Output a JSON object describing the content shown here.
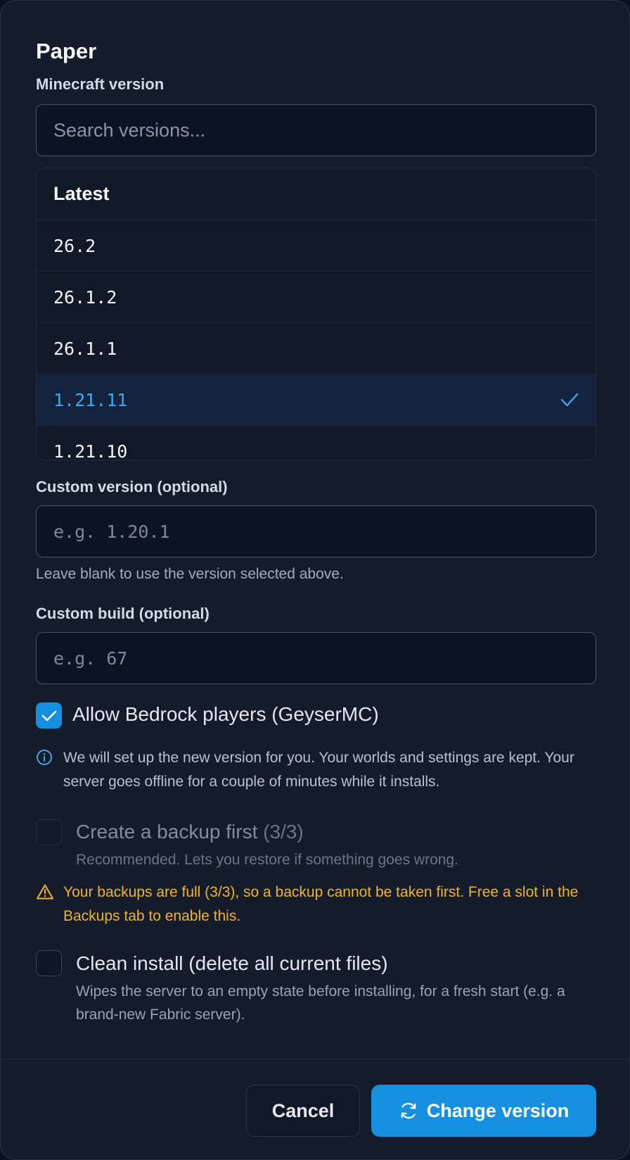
{
  "title": "Paper",
  "version_section": {
    "label": "Minecraft version",
    "search_placeholder": "Search versions...",
    "list_header": "Latest",
    "versions": [
      "26.2",
      "26.1.2",
      "26.1.1",
      "1.21.11",
      "1.21.10"
    ],
    "selected_version": "1.21.11"
  },
  "custom_version": {
    "label": "Custom version (optional)",
    "placeholder": "e.g. 1.20.1",
    "help": "Leave blank to use the version selected above."
  },
  "custom_build": {
    "label": "Custom build (optional)",
    "placeholder": "e.g. 67"
  },
  "bedrock": {
    "label": "Allow Bedrock players (GeyserMC)",
    "checked": true
  },
  "info_notice": "We will set up the new version for you. Your worlds and settings are kept. Your server goes offline for a couple of minutes while it installs.",
  "backup": {
    "label": "Create a backup first",
    "count": "(3/3)",
    "description": "Recommended. Lets you restore if something goes wrong.",
    "checked": false,
    "disabled": true
  },
  "warning_notice": "Your backups are full (3/3), so a backup cannot be taken first. Free a slot in the Backups tab to enable this.",
  "clean_install": {
    "label": "Clean install (delete all current files)",
    "description": "Wipes the server to an empty state before installing, for a fresh start (e.g. a brand-new Fabric server).",
    "checked": false
  },
  "footer": {
    "cancel_label": "Cancel",
    "submit_label": "Change version"
  },
  "colors": {
    "accent": "#1590e0",
    "selected_text": "#3fa6f0",
    "warning": "#f0b429"
  }
}
